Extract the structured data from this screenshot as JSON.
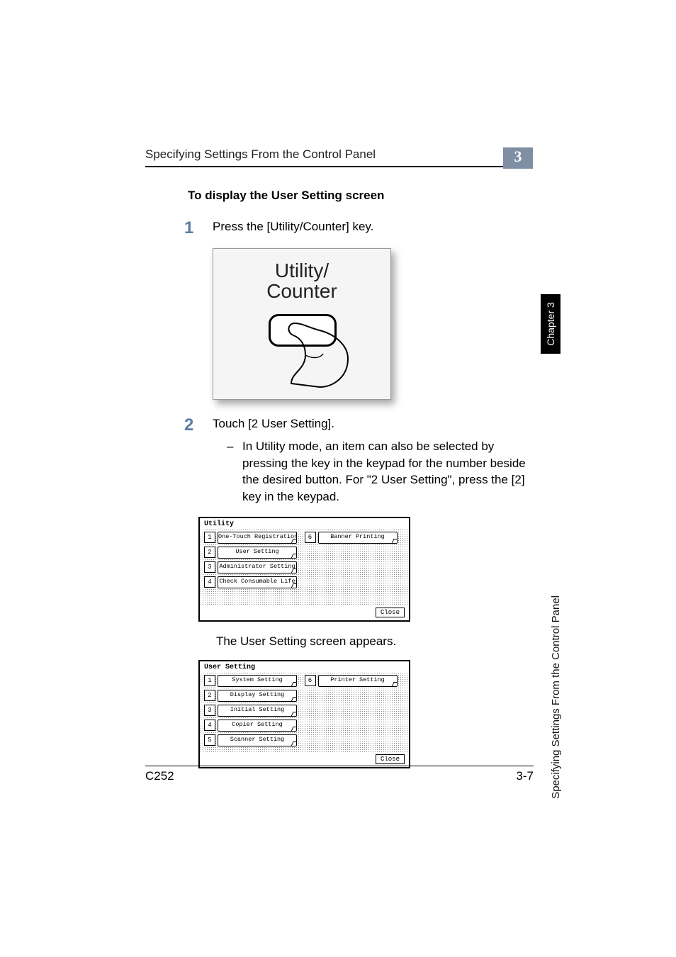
{
  "header": {
    "running_title": "Specifying Settings From the Control Panel",
    "chapter_number": "3"
  },
  "side": {
    "chapter_label": "Chapter 3",
    "section_label": "Specifying Settings From the Control Panel"
  },
  "content": {
    "subheading": "To display the User Setting screen",
    "steps": [
      {
        "num": "1",
        "text": "Press the [Utility/Counter] key."
      },
      {
        "num": "2",
        "text": "Touch [2 User Setting].",
        "sub": [
          {
            "dash": "–",
            "text": "In Utility mode, an item can also be selected by pressing the key in the keypad for the number beside the desired button. For \"2 User Setting\", press the [2] key in the keypad."
          }
        ]
      }
    ],
    "result": "The User Setting screen appears."
  },
  "key": {
    "line1": "Utility/",
    "line2": "Counter"
  },
  "panels": {
    "utility": {
      "title": "Utility",
      "left": [
        {
          "n": "1",
          "label": "One-Touch Registration"
        },
        {
          "n": "2",
          "label": "User Setting"
        },
        {
          "n": "3",
          "label": "Administrator Setting"
        },
        {
          "n": "4",
          "label": "Check Consumable Life"
        }
      ],
      "right": [
        {
          "n": "6",
          "label": "Banner Printing"
        }
      ],
      "close": "Close"
    },
    "user_setting": {
      "title": "User Setting",
      "left": [
        {
          "n": "1",
          "label": "System Setting"
        },
        {
          "n": "2",
          "label": "Display Setting"
        },
        {
          "n": "3",
          "label": "Initial Setting"
        },
        {
          "n": "4",
          "label": "Copier Setting"
        },
        {
          "n": "5",
          "label": "Scanner Setting"
        }
      ],
      "right": [
        {
          "n": "6",
          "label": "Printer Setting"
        }
      ],
      "close": "Close"
    }
  },
  "footer": {
    "model": "C252",
    "page": "3-7"
  }
}
